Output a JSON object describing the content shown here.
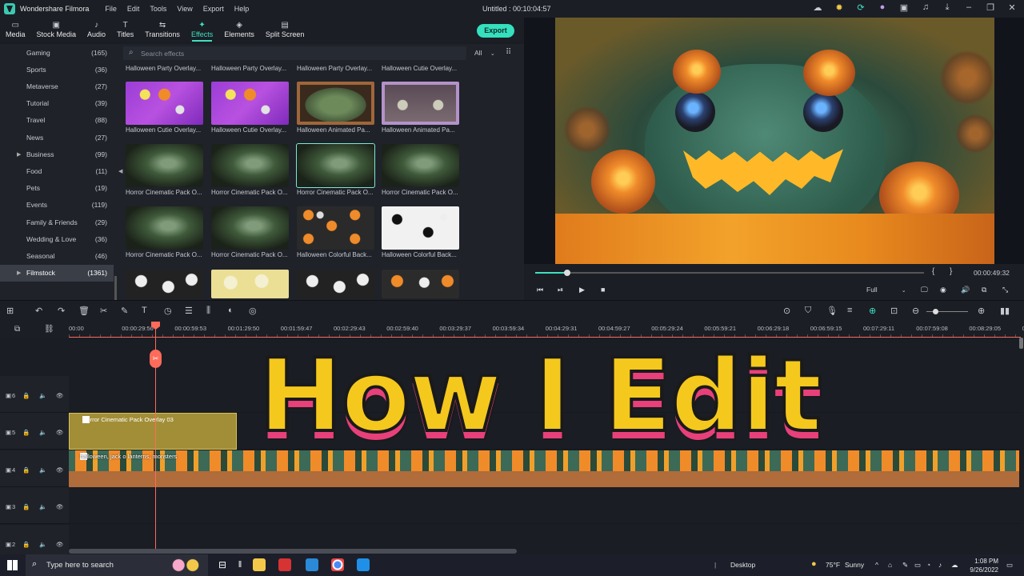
{
  "window": {
    "app_name": "Wondershare Filmora",
    "title": "Untitled : 00:10:04:57"
  },
  "menu": [
    "File",
    "Edit",
    "Tools",
    "View",
    "Export",
    "Help"
  ],
  "toolbar": {
    "tabs": [
      {
        "label": "Media",
        "icon": "folder-icon"
      },
      {
        "label": "Stock Media",
        "icon": "stock-media-icon"
      },
      {
        "label": "Audio",
        "icon": "music-note-icon"
      },
      {
        "label": "Titles",
        "icon": "title-t-icon"
      },
      {
        "label": "Transitions",
        "icon": "transitions-icon"
      },
      {
        "label": "Effects",
        "icon": "effects-sparkle-icon",
        "active": true
      },
      {
        "label": "Elements",
        "icon": "elements-icon"
      },
      {
        "label": "Split Screen",
        "icon": "split-screen-icon"
      }
    ],
    "export_label": "Export"
  },
  "sidebar": {
    "categories": [
      {
        "label": "Gaming",
        "count": "(165)"
      },
      {
        "label": "Sports",
        "count": "(36)"
      },
      {
        "label": "Metaverse",
        "count": "(27)"
      },
      {
        "label": "Tutorial",
        "count": "(39)"
      },
      {
        "label": "Travel",
        "count": "(88)"
      },
      {
        "label": "News",
        "count": "(27)"
      },
      {
        "label": "Business",
        "count": "(99)",
        "expandable": true
      },
      {
        "label": "Food",
        "count": "(11)"
      },
      {
        "label": "Pets",
        "count": "(19)"
      },
      {
        "label": "Events",
        "count": "(119)"
      },
      {
        "label": "Family & Friends",
        "count": "(29)"
      },
      {
        "label": "Wedding & Love",
        "count": "(36)"
      },
      {
        "label": "Seasonal",
        "count": "(46)"
      },
      {
        "label": "Filmstock",
        "count": "(1361)",
        "selected": true,
        "expandable": true
      }
    ]
  },
  "effects": {
    "search_placeholder": "Search effects",
    "filter_value": "All",
    "top_row_labels": [
      "Halloween Party Overlay...",
      "Halloween Party Overlay...",
      "Halloween Party Overlay...",
      "Halloween Cutie Overlay..."
    ],
    "rows": [
      [
        "Halloween Cutie Overlay...",
        "Halloween Cutie Overlay...",
        "Halloween Animated Pa...",
        "Halloween Animated Pa..."
      ],
      [
        "Horror Cinematic Pack O...",
        "Horror Cinematic Pack O...",
        "Horror Cinematic Pack O...",
        "Horror Cinematic Pack O..."
      ],
      [
        "Horror Cinematic Pack O...",
        "Horror Cinematic Pack O...",
        "Halloween Colorful Back...",
        "Halloween Colorful Back..."
      ]
    ]
  },
  "player": {
    "time": "00:00:49:32",
    "progress_fraction": 0.08,
    "quality": "Full",
    "mark_in": "{",
    "mark_out": "}"
  },
  "timeline": {
    "ruler": [
      "00:00",
      "00:00:29:56",
      "00:00:59:53",
      "00:01:29:50",
      "00:01:59:47",
      "00:02:29:43",
      "00:02:59:40",
      "00:03:29:37",
      "00:03:59:34",
      "00:04:29:31",
      "00:04:59:27",
      "00:05:29:24",
      "00:05:59:21",
      "00:06:29:18",
      "00:06:59:15",
      "00:07:29:11",
      "00:07:59:08",
      "00:08:29:05",
      "00:08:5"
    ],
    "tracks": [
      "6",
      "5",
      "4",
      "3",
      "2"
    ],
    "clip_overlay": "Horror Cinematic Pack Overlay 03",
    "clip_video": "halloween, jack o lanterns, monsters"
  },
  "overlay_title": "How I Edit",
  "taskbar": {
    "search_placeholder": "Type here to search",
    "desktop_label": "Desktop",
    "weather_temp": "75°F",
    "weather_desc": "Sunny",
    "time": "1:08 PM",
    "date": "9/26/2022"
  }
}
